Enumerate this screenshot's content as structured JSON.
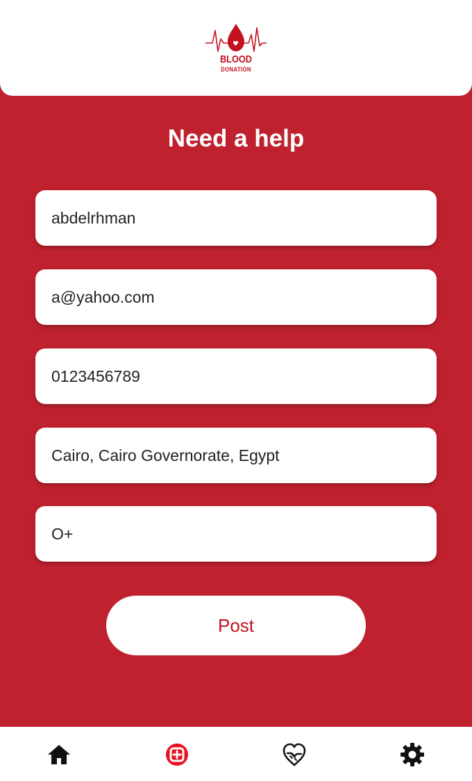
{
  "header": {
    "logo_line1": "BLOOD",
    "logo_line2": "DONATION"
  },
  "page": {
    "title": "Need a help"
  },
  "form": {
    "name_value": "abdelrhman",
    "email_value": "a@yahoo.com",
    "phone_value": "0123456789",
    "location_value": "Cairo, Cairo Governorate, Egypt",
    "blood_type_value": "O+",
    "post_label": "Post"
  },
  "nav": {
    "items": [
      {
        "icon": "home-icon",
        "active": false
      },
      {
        "icon": "help-request-icon",
        "active": true
      },
      {
        "icon": "heart-hands-icon",
        "active": false
      },
      {
        "icon": "gear-icon",
        "active": false
      }
    ]
  },
  "colors": {
    "brand_red": "#bf222e",
    "accent_red": "#e8101e",
    "white": "#ffffff"
  }
}
